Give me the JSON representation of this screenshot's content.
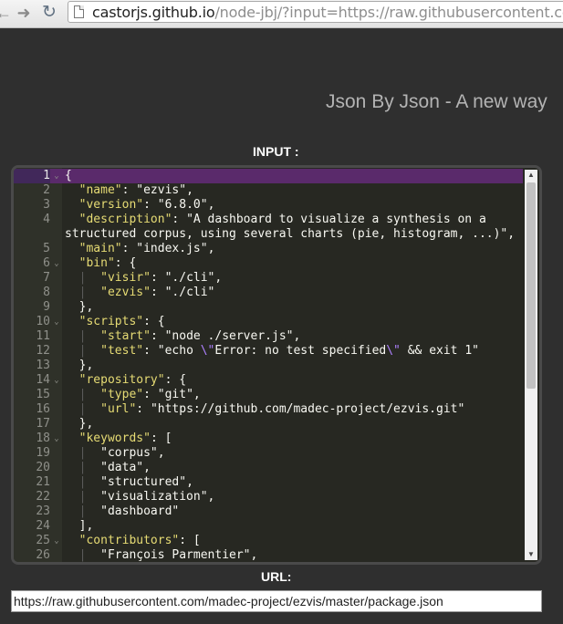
{
  "browser": {
    "back_icon": "back-arrow-icon",
    "forward_icon": "forward-arrow-icon",
    "reload_icon": "reload-icon",
    "url_host": "castorjs.github.io",
    "url_path": "/node-jbj/?input=https://raw.githubusercontent.com/ma"
  },
  "app": {
    "title": "Json By Json - A new way"
  },
  "input_section": {
    "label": "INPUT :"
  },
  "editor": {
    "active_line": 1,
    "lines": [
      {
        "n": "1",
        "fold": true,
        "tokens": [
          [
            "p",
            "{"
          ]
        ]
      },
      {
        "n": "2",
        "tokens": [
          [
            "p",
            "  "
          ],
          [
            "k",
            "\"name\""
          ],
          [
            "p",
            ": "
          ],
          [
            "s",
            "\"ezvis\""
          ],
          [
            "p",
            ","
          ]
        ]
      },
      {
        "n": "3",
        "tokens": [
          [
            "p",
            "  "
          ],
          [
            "k",
            "\"version\""
          ],
          [
            "p",
            ": "
          ],
          [
            "s",
            "\"6.8.0\""
          ],
          [
            "p",
            ","
          ]
        ]
      },
      {
        "n": "4",
        "tokens": [
          [
            "p",
            "  "
          ],
          [
            "k",
            "\"description\""
          ],
          [
            "p",
            ": "
          ],
          [
            "s",
            "\"A dashboard to visualize a synthesis on a"
          ]
        ]
      },
      {
        "n": "",
        "tokens": [
          [
            "s",
            "structured corpus, using several charts (pie, histogram, ...)\""
          ],
          [
            "p",
            ","
          ]
        ]
      },
      {
        "n": "5",
        "tokens": [
          [
            "p",
            "  "
          ],
          [
            "k",
            "\"main\""
          ],
          [
            "p",
            ": "
          ],
          [
            "s",
            "\"index.js\""
          ],
          [
            "p",
            ","
          ]
        ]
      },
      {
        "n": "6",
        "fold": true,
        "tokens": [
          [
            "p",
            "  "
          ],
          [
            "k",
            "\"bin\""
          ],
          [
            "p",
            ": {"
          ]
        ]
      },
      {
        "n": "7",
        "tokens": [
          [
            "p",
            "  "
          ],
          [
            "g",
            "|"
          ],
          [
            "p",
            "  "
          ],
          [
            "k",
            "\"visir\""
          ],
          [
            "p",
            ": "
          ],
          [
            "s",
            "\"./cli\""
          ],
          [
            "p",
            ","
          ]
        ]
      },
      {
        "n": "8",
        "tokens": [
          [
            "p",
            "  "
          ],
          [
            "g",
            "|"
          ],
          [
            "p",
            "  "
          ],
          [
            "k",
            "\"ezvis\""
          ],
          [
            "p",
            ": "
          ],
          [
            "s",
            "\"./cli\""
          ]
        ]
      },
      {
        "n": "9",
        "tokens": [
          [
            "p",
            "  },"
          ]
        ]
      },
      {
        "n": "10",
        "fold": true,
        "tokens": [
          [
            "p",
            "  "
          ],
          [
            "k",
            "\"scripts\""
          ],
          [
            "p",
            ": {"
          ]
        ]
      },
      {
        "n": "11",
        "tokens": [
          [
            "p",
            "  "
          ],
          [
            "g",
            "|"
          ],
          [
            "p",
            "  "
          ],
          [
            "k",
            "\"start\""
          ],
          [
            "p",
            ": "
          ],
          [
            "s",
            "\"node ./server.js\""
          ],
          [
            "p",
            ","
          ]
        ]
      },
      {
        "n": "12",
        "tokens": [
          [
            "p",
            "  "
          ],
          [
            "g",
            "|"
          ],
          [
            "p",
            "  "
          ],
          [
            "k",
            "\"test\""
          ],
          [
            "p",
            ": "
          ],
          [
            "s",
            "\"echo "
          ],
          [
            "e",
            "\\\""
          ],
          [
            "s",
            "Error: no test specified"
          ],
          [
            "e",
            "\\\""
          ],
          [
            "s",
            " && exit 1\""
          ]
        ]
      },
      {
        "n": "13",
        "tokens": [
          [
            "p",
            "  },"
          ]
        ]
      },
      {
        "n": "14",
        "fold": true,
        "tokens": [
          [
            "p",
            "  "
          ],
          [
            "k",
            "\"repository\""
          ],
          [
            "p",
            ": {"
          ]
        ]
      },
      {
        "n": "15",
        "tokens": [
          [
            "p",
            "  "
          ],
          [
            "g",
            "|"
          ],
          [
            "p",
            "  "
          ],
          [
            "k",
            "\"type\""
          ],
          [
            "p",
            ": "
          ],
          [
            "s",
            "\"git\""
          ],
          [
            "p",
            ","
          ]
        ]
      },
      {
        "n": "16",
        "tokens": [
          [
            "p",
            "  "
          ],
          [
            "g",
            "|"
          ],
          [
            "p",
            "  "
          ],
          [
            "k",
            "\"url\""
          ],
          [
            "p",
            ": "
          ],
          [
            "s",
            "\"https://github.com/madec-project/ezvis.git\""
          ]
        ]
      },
      {
        "n": "17",
        "tokens": [
          [
            "p",
            "  },"
          ]
        ]
      },
      {
        "n": "18",
        "fold": true,
        "tokens": [
          [
            "p",
            "  "
          ],
          [
            "k",
            "\"keywords\""
          ],
          [
            "p",
            ": ["
          ]
        ]
      },
      {
        "n": "19",
        "tokens": [
          [
            "p",
            "  "
          ],
          [
            "g",
            "|"
          ],
          [
            "p",
            "  "
          ],
          [
            "s",
            "\"corpus\""
          ],
          [
            "p",
            ","
          ]
        ]
      },
      {
        "n": "20",
        "tokens": [
          [
            "p",
            "  "
          ],
          [
            "g",
            "|"
          ],
          [
            "p",
            "  "
          ],
          [
            "s",
            "\"data\""
          ],
          [
            "p",
            ","
          ]
        ]
      },
      {
        "n": "21",
        "tokens": [
          [
            "p",
            "  "
          ],
          [
            "g",
            "|"
          ],
          [
            "p",
            "  "
          ],
          [
            "s",
            "\"structured\""
          ],
          [
            "p",
            ","
          ]
        ]
      },
      {
        "n": "22",
        "tokens": [
          [
            "p",
            "  "
          ],
          [
            "g",
            "|"
          ],
          [
            "p",
            "  "
          ],
          [
            "s",
            "\"visualization\""
          ],
          [
            "p",
            ","
          ]
        ]
      },
      {
        "n": "23",
        "tokens": [
          [
            "p",
            "  "
          ],
          [
            "g",
            "|"
          ],
          [
            "p",
            "  "
          ],
          [
            "s",
            "\"dashboard\""
          ]
        ]
      },
      {
        "n": "24",
        "tokens": [
          [
            "p",
            "  ],"
          ]
        ]
      },
      {
        "n": "25",
        "fold": true,
        "tokens": [
          [
            "p",
            "  "
          ],
          [
            "k",
            "\"contributors\""
          ],
          [
            "p",
            ": ["
          ]
        ]
      },
      {
        "n": "26",
        "tokens": [
          [
            "p",
            "  "
          ],
          [
            "g",
            "|"
          ],
          [
            "p",
            "  "
          ],
          [
            "s",
            "\"François Parmentier\""
          ],
          [
            "p",
            ","
          ]
        ]
      }
    ],
    "scroll_position": 0
  },
  "url_section": {
    "label": "URL:",
    "value": "https://raw.githubusercontent.com/madec-project/ezvis/master/package.json"
  }
}
